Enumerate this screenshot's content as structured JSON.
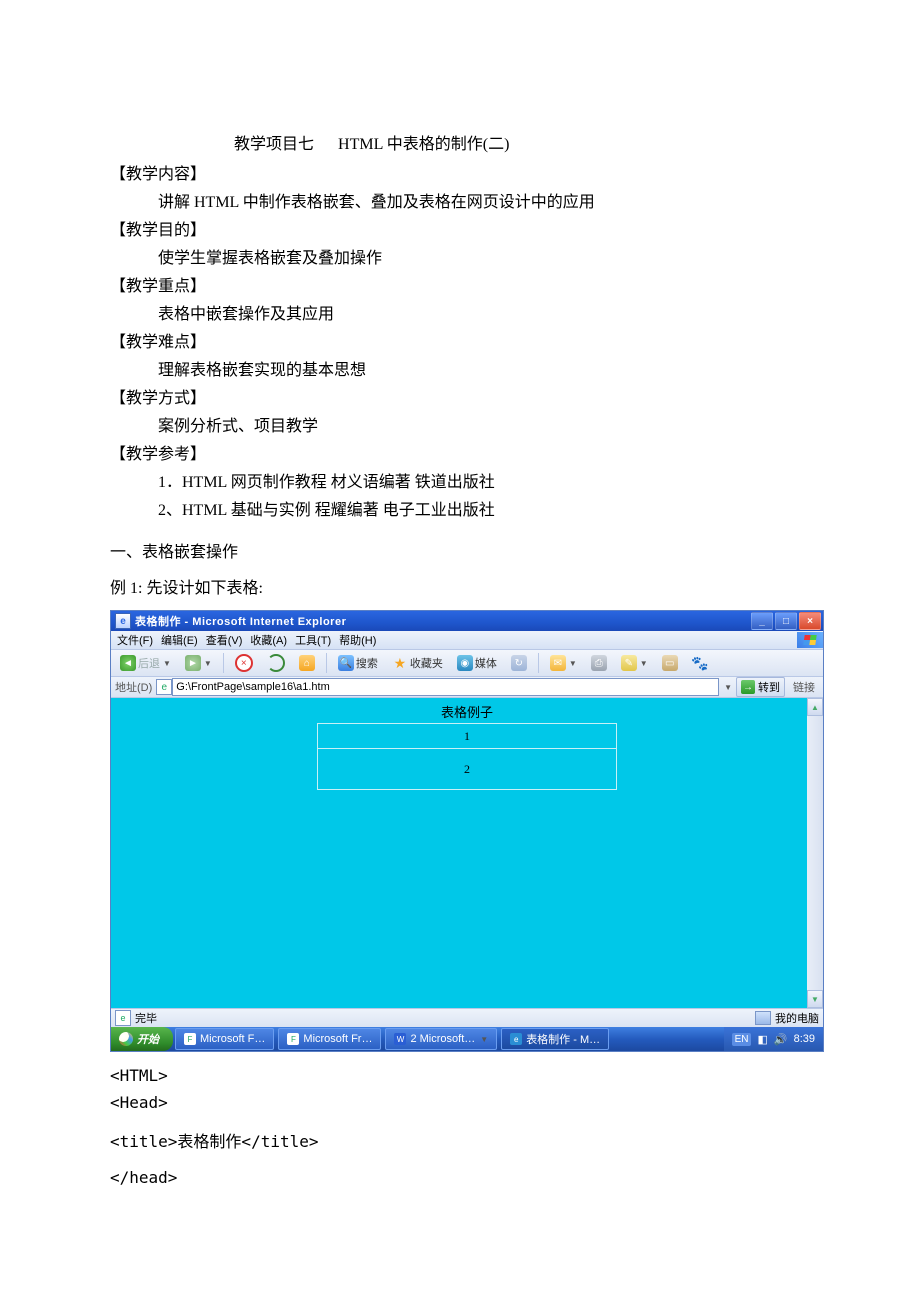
{
  "doc": {
    "title_prefix": "教学项目七",
    "title_main": "HTML 中表格的制作(二)",
    "sections": {
      "content_label": "【教学内容】",
      "content_text": "讲解 HTML 中制作表格嵌套、叠加及表格在网页设计中的应用",
      "goal_label": "【教学目的】",
      "goal_text": "使学生掌握表格嵌套及叠加操作",
      "focus_label": "【教学重点】",
      "focus_text": "表格中嵌套操作及其应用",
      "hard_label": "【教学难点】",
      "hard_text": "理解表格嵌套实现的基本思想",
      "method_label": "【教学方式】",
      "method_text": "案例分析式、项目教学",
      "ref_label": "【教学参考】",
      "ref1": "1．HTML 网页制作教程      材义语编著  铁道出版社",
      "ref2": "2、HTML 基础与实例     程耀编著  电子工业出版社"
    },
    "section1": "一、表格嵌套操作",
    "example1": "例 1:  先设计如下表格:",
    "code": {
      "l1": "<HTML>",
      "l2": "<Head>",
      "l3": "<title>表格制作</title>",
      "l4": "</head>"
    }
  },
  "ie": {
    "title": "表格制作 - Microsoft Internet Explorer",
    "menu": {
      "file": "文件(F)",
      "edit": "编辑(E)",
      "view": "查看(V)",
      "fav": "收藏(A)",
      "tool": "工具(T)",
      "help": "帮助(H)"
    },
    "tb": {
      "back": "后退",
      "search": "搜索",
      "fav": "收藏夹",
      "media": "媒体"
    },
    "addr_label": "地址(D)",
    "addr_value": "G:\\FrontPage\\sample16\\a1.htm",
    "go": "转到",
    "links": "链接",
    "page": {
      "caption": "表格例子",
      "row1": "1",
      "row2": "2"
    },
    "status_done": "完毕",
    "status_zone": "我的电脑"
  },
  "taskbar": {
    "start": "开始",
    "items": [
      {
        "label": "Microsoft F…",
        "kind": "app"
      },
      {
        "label": "Microsoft Fr…",
        "kind": "app"
      },
      {
        "label": "2 Microsoft…",
        "kind": "word"
      },
      {
        "label": "表格制作 - M…",
        "kind": "ie"
      }
    ],
    "lang": "EN",
    "time": "8:39"
  }
}
